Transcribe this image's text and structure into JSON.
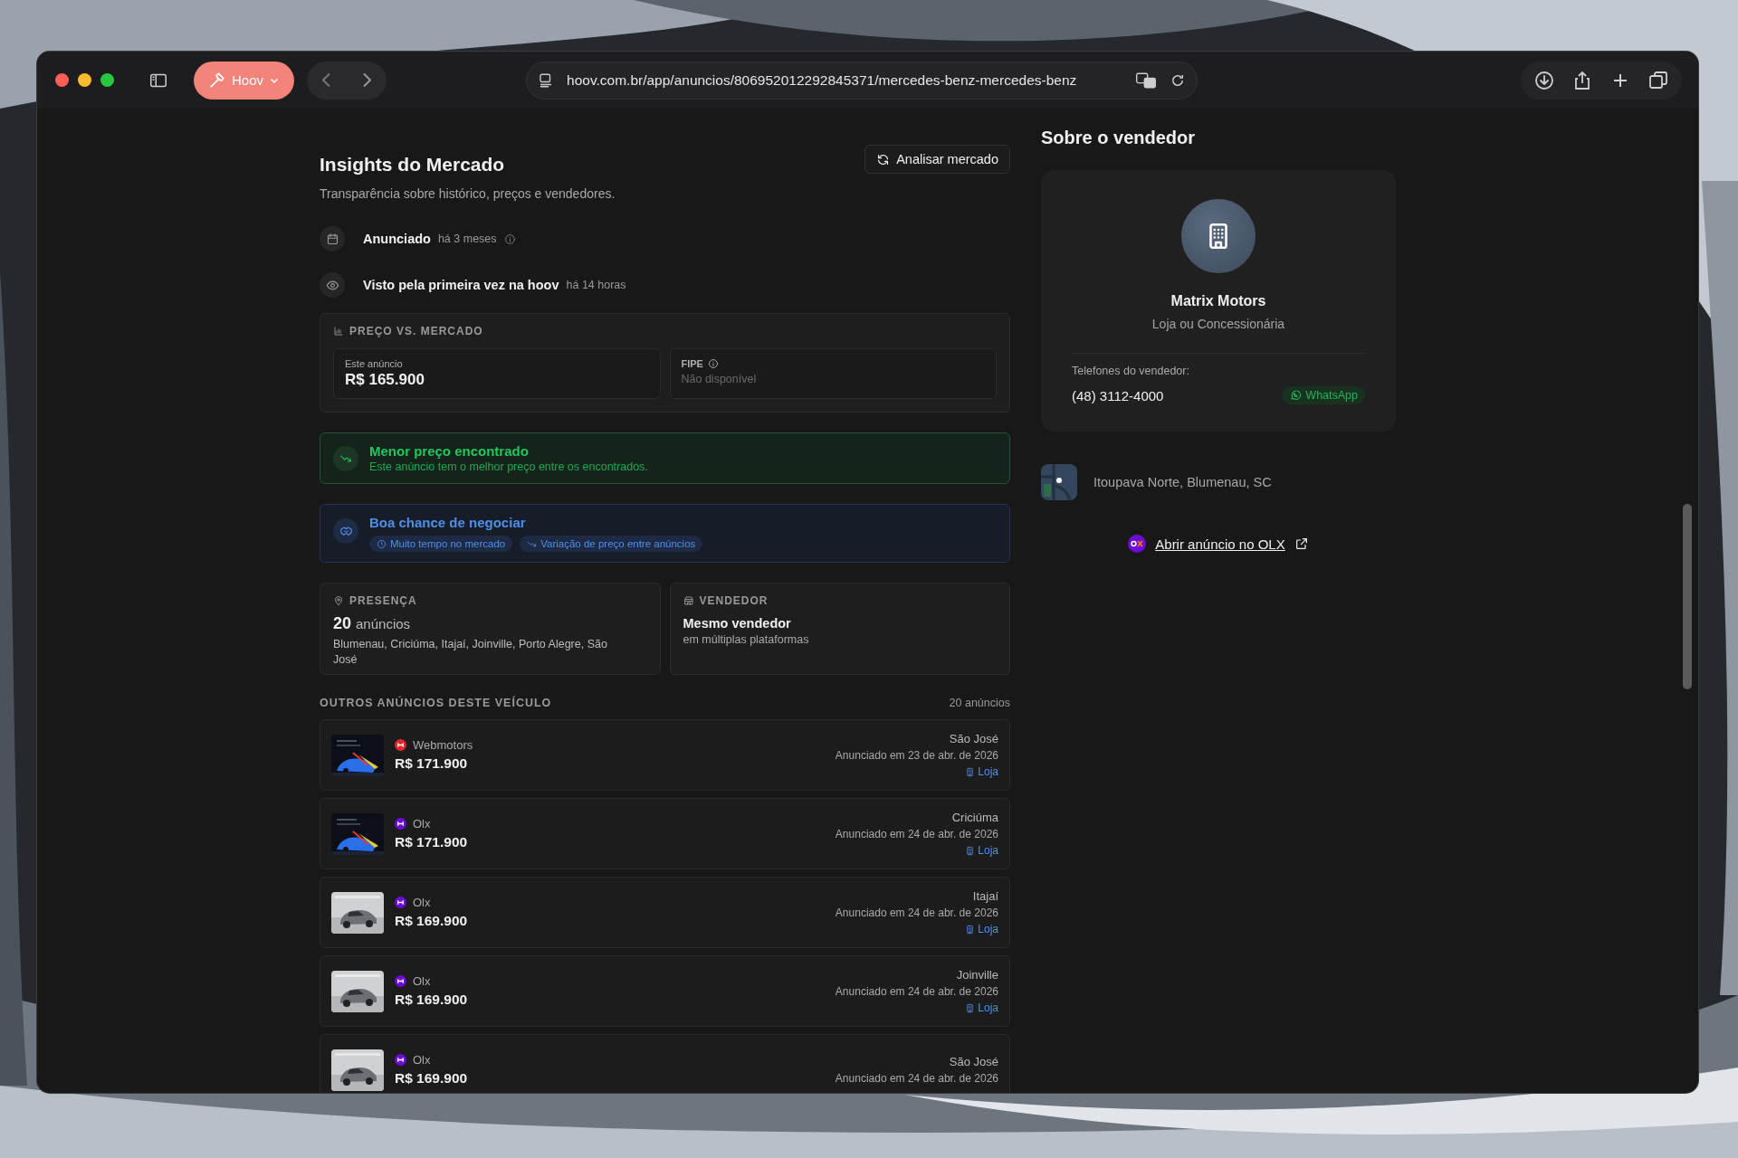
{
  "browser": {
    "tab_group": "Hoov",
    "url": "hoov.com.br/app/anuncios/806952012292845371/mercedes-benz-mercedes-benz"
  },
  "insights": {
    "title": "Insights do Mercado",
    "subtitle": "Transparência sobre histórico, preços e vendedores.",
    "analyze_button": "Analisar mercado",
    "timeline": [
      {
        "kind": "announced",
        "label": "Anunciado",
        "time": "há 3 meses",
        "info": true
      },
      {
        "kind": "seen",
        "label": "Visto pela primeira vez na hoov",
        "time": "há 14 horas",
        "info": false
      }
    ],
    "price_vs_market": {
      "heading": "PREÇO VS. MERCADO",
      "this_listing": {
        "label": "Este anúncio",
        "value": "R$ 165.900"
      },
      "fipe": {
        "label": "FIPE",
        "value": "Não disponível"
      }
    },
    "lowest_price": {
      "title": "Menor preço encontrado",
      "text": "Este anúncio tem o melhor preço entre os encontrados."
    },
    "negotiation": {
      "title": "Boa chance de negociar",
      "tags": [
        {
          "kind": "time",
          "label": "Muito tempo no mercado"
        },
        {
          "kind": "trend",
          "label": "Variação de preço entre anúncios"
        }
      ]
    },
    "presence": {
      "heading": "PRESENÇA",
      "count": "20",
      "count_label": "anúncios",
      "cities": "Blumenau, Criciúma, Itajaí, Joinville, Porto Alegre, São José"
    },
    "seller_info": {
      "heading": "VENDEDOR",
      "title": "Mesmo vendedor",
      "text": "em múltiplas plataformas"
    },
    "other_listings": {
      "heading": "OUTROS ANÚNCIOS DESTE VEÍCULO",
      "count": "20 anúncios",
      "rows": [
        {
          "source": "Webmotors",
          "color": "#e5262b",
          "price": "R$ 171.900",
          "city": "São José",
          "date": "Anunciado em 23 de abr. de 2026",
          "store": "Loja"
        },
        {
          "source": "Olx",
          "color": "#6e0ad6",
          "price": "R$ 171.900",
          "city": "Criciúma",
          "date": "Anunciado em 24 de abr. de 2026",
          "store": "Loja"
        },
        {
          "source": "Olx",
          "color": "#6e0ad6",
          "price": "R$ 169.900",
          "city": "Itajaí",
          "date": "Anunciado em 24 de abr. de 2026",
          "store": "Loja"
        },
        {
          "source": "Olx",
          "color": "#6e0ad6",
          "price": "R$ 169.900",
          "city": "Joinville",
          "date": "Anunciado em 24 de abr. de 2026",
          "store": "Loja"
        },
        {
          "source": "Olx",
          "color": "#6e0ad6",
          "price": "R$ 169.900",
          "city": "São José",
          "date": "Anunciado em 24 de abr. de 2026"
        }
      ]
    }
  },
  "seller": {
    "heading": "Sobre o vendedor",
    "name": "Matrix Motors",
    "type": "Loja ou Concessionária",
    "phones_label": "Telefones do vendedor:",
    "phone": "(48) 3112-4000",
    "whatsapp": "WhatsApp",
    "location": "Itoupava Norte, Blumenau, SC",
    "link": "Abrir anúncio no OLX"
  }
}
